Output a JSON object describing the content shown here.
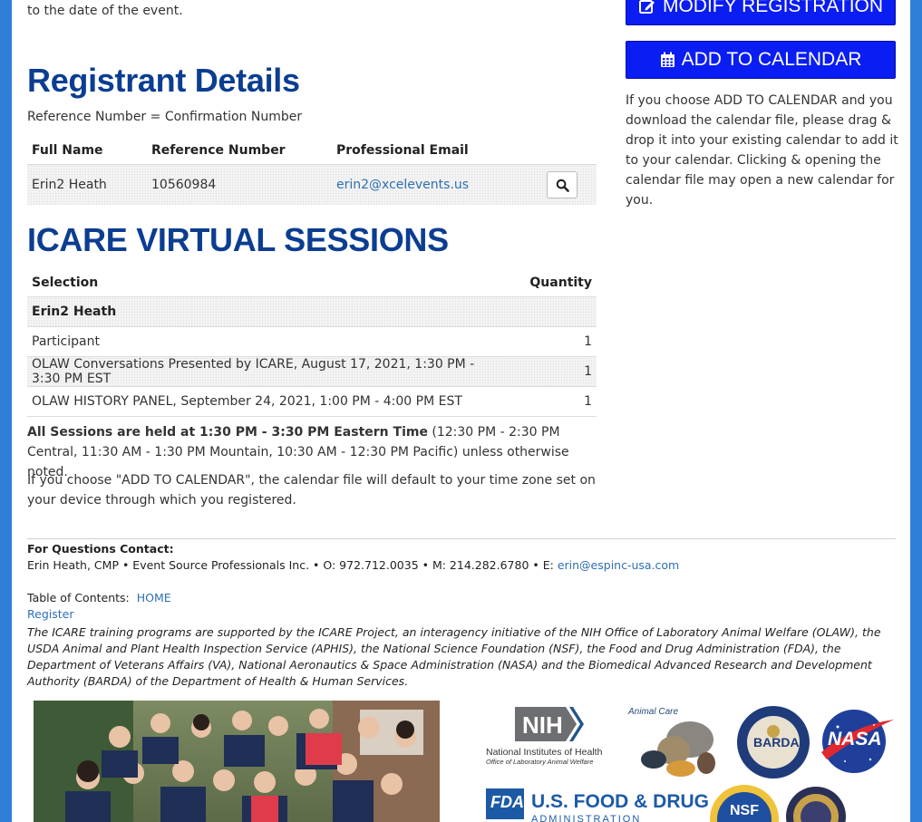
{
  "intro": {
    "line": "to the date of the event."
  },
  "registrant": {
    "title": "Registrant Details",
    "note": "Reference Number = Confirmation Number",
    "columns": [
      "Full Name",
      "Reference Number",
      "Professional Email"
    ],
    "row": {
      "name": "Erin2 Heath",
      "reference": "10560984",
      "email": "erin2@xcelevents.us"
    }
  },
  "sessions": {
    "title": "ICARE VIRTUAL SESSIONS",
    "col_selection": "Selection",
    "col_quantity": "Quantity",
    "group": "Erin2 Heath",
    "items": [
      {
        "label": "Participant",
        "qty": "1"
      },
      {
        "label": "OLAW Conversations Presented by ICARE, August 17, 2021, 1:30 PM - 3:30 PM EST",
        "qty": "1"
      },
      {
        "label": "OLAW HISTORY PANEL, September 24, 2021, 1:00 PM - 4:00 PM EST",
        "qty": "1"
      }
    ],
    "note_bold": "All Sessions are held at 1:30 PM - 3:30 PM Eastern Time",
    "note_rest": " (12:30 PM - 2:30 PM Central, 11:30 AM - 1:30 PM Mountain, 10:30 AM - 12:30 PM Pacific) unless otherwise noted.",
    "calendar_note": "If you choose \"ADD TO CALENDAR\", the calendar file will default to your time zone set on your device through which you registered."
  },
  "sidebar": {
    "modify_label": "MODIFY REGISTRATION",
    "calendar_label": "ADD TO CALENDAR",
    "help_text": "If you choose ADD TO CALENDAR and you download the calendar file, please drag & drop it into your existing calendar to add it to your calendar. Clicking & opening the calendar file may open a new calendar for you."
  },
  "footer": {
    "contact_heading": "For Questions Contact:",
    "contact_text": "Erin Heath, CMP • Event Source Professionals Inc. • O: 972.712.0035 • M: 214.282.6780 • E: ",
    "contact_email": "erin@espinc-usa.com",
    "toc_label": "Table of Contents:",
    "toc_home": "HOME",
    "toc_register": "Register",
    "support_text": "The ICARE training programs are supported by the ICARE Project, an interagency initiative of the NIH Office of Laboratory Animal Welfare (OLAW), the USDA Animal and Plant Health Inspection Service (APHIS), the National Science Foundation (NSF), the Food and Drug Administration (FDA), the Department of Veterans Affairs (VA), National Aeronautics & Space Administration (NASA) and the Biomedical Advanced Research and Development Authority (BARDA) of the Department of Health & Human Services."
  },
  "logos": {
    "nih_mark": "NIH",
    "nih_name": "National Institutes of Health",
    "nih_sub": "Office of Laboratory Animal Welfare",
    "animal_care": "Animal Care",
    "barda": "BARDA",
    "nasa": "NASA",
    "fda_mark": "FDA",
    "fda_text": "U.S. FOOD & DRUG",
    "fda_sub": "ADMINISTRATION",
    "nsf": "NSF"
  },
  "colors": {
    "heading": "#0b3d91",
    "button": "#0a1df2",
    "link": "#2e6fb4",
    "frame": "#2f7fd9"
  }
}
